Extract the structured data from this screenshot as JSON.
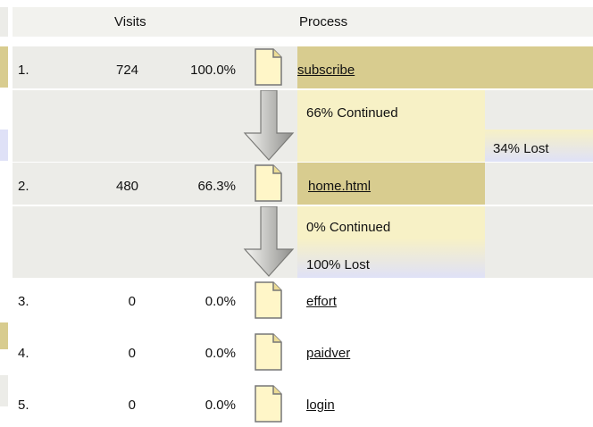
{
  "table": {
    "headers": {
      "visits": "Visits",
      "process": "Process"
    },
    "rows": [
      {
        "index": "1.",
        "visits": "724",
        "percent": "100.0%",
        "page": "subscribe"
      },
      {
        "index": "2.",
        "visits": "480",
        "percent": "66.3%",
        "page": "home.html"
      },
      {
        "index": "3.",
        "visits": "0",
        "percent": "0.0%",
        "page": "effort"
      },
      {
        "index": "4.",
        "visits": "0",
        "percent": "0.0%",
        "page": "paidver"
      },
      {
        "index": "5.",
        "visits": "0",
        "percent": "0.0%",
        "page": "login"
      }
    ],
    "transitions": [
      {
        "continued": "66% Continued",
        "lost": "34% Lost"
      },
      {
        "continued": "0% Continued",
        "lost": "100% Lost"
      }
    ]
  },
  "colors": {
    "page_gold": "#d8cc8f",
    "continued_cream": "#f7f1c6",
    "lost_lavender": "#dfe1f7",
    "header_grey": "#f2f2ee"
  },
  "icons": {
    "page": "document-icon",
    "flow": "down-arrow-icon"
  }
}
